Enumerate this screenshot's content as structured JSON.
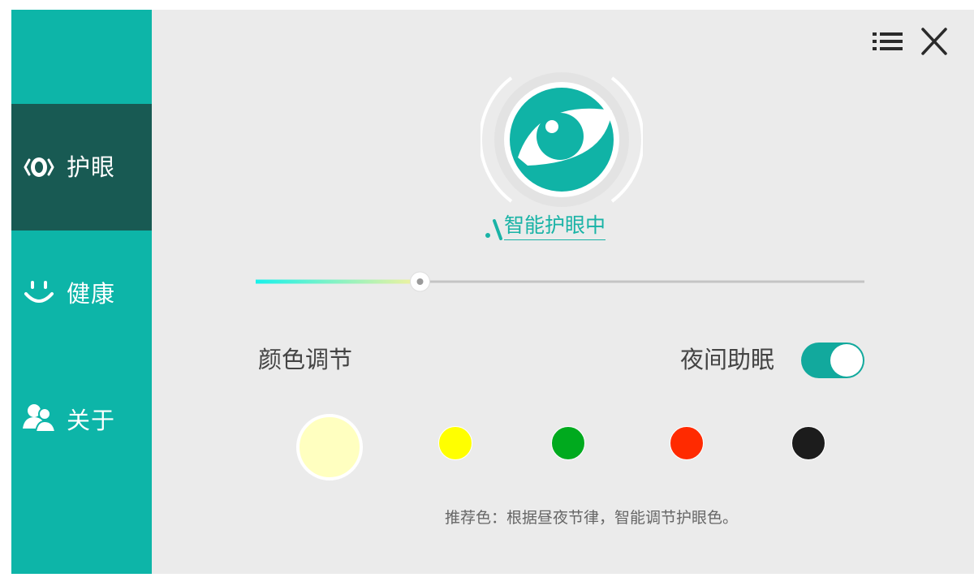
{
  "sidebar": {
    "items": [
      {
        "label": "护眼",
        "icon": "eye-icon",
        "active": true
      },
      {
        "label": "健康",
        "icon": "smile-icon",
        "active": false
      },
      {
        "label": "关于",
        "icon": "users-icon",
        "active": false
      }
    ]
  },
  "toolbar": {
    "menu_icon": "menu-icon",
    "close_icon": "close-icon"
  },
  "status": {
    "text": "智能护眼中",
    "icon": "eye-icon"
  },
  "slider": {
    "value": 0.27
  },
  "color_section": {
    "label": "颜色调节",
    "selected_index": 0,
    "swatches": [
      "#ffffc0",
      "#ffff00",
      "#00aa1e",
      "#ff2a00",
      "#1c1c1c"
    ]
  },
  "night_mode": {
    "label": "夜间助眠",
    "enabled": true
  },
  "tip": {
    "text": "推荐色：根据昼夜节律，智能调节护眼色。"
  },
  "colors": {
    "accent": "#0db5a8",
    "sidebar_active": "#185a53",
    "background": "#ebebeb"
  }
}
